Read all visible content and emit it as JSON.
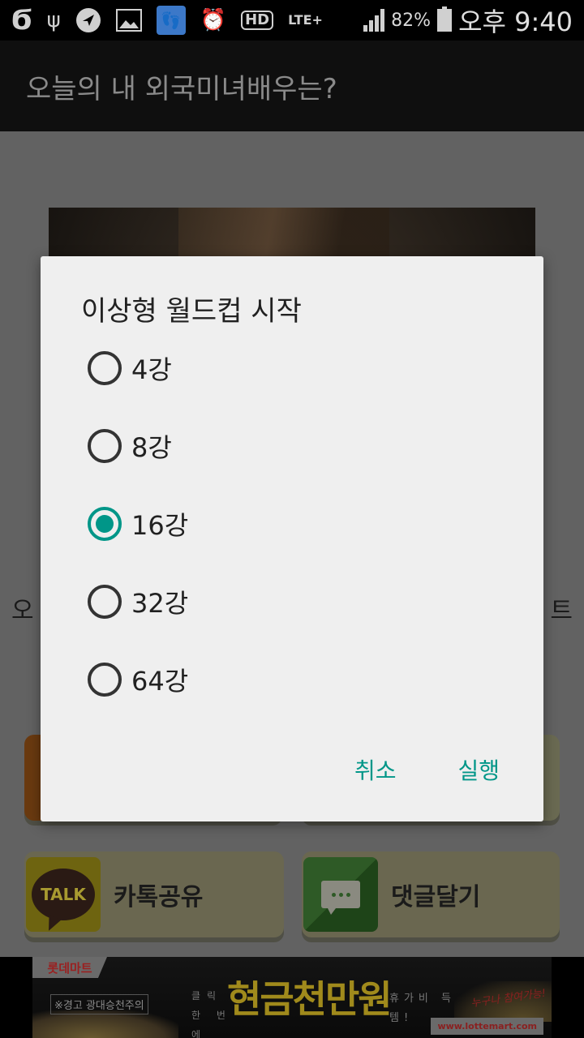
{
  "status_bar": {
    "icons": [
      "g-app-icon",
      "usb-icon",
      "navigation-icon",
      "gallery-icon",
      "app-footprint-icon",
      "alarm-icon",
      "hd-voice-icon",
      "lte-plus-icon",
      "signal-icon",
      "battery-charging-icon"
    ],
    "hd_label": "HD",
    "lte_label": "LTE+",
    "battery_percent": "82%",
    "time": "오후 9:40"
  },
  "app_bar": {
    "title": "오늘의 내 외국미녀배우는?"
  },
  "content": {
    "side_text_left": "오",
    "side_text_right": "트",
    "buttons": [
      {
        "label": "카톡공유",
        "icon": "kakaotalk-icon",
        "icon_text": "TALK"
      },
      {
        "label": "댓글달기",
        "icon": "comment-icon"
      }
    ]
  },
  "dialog": {
    "title": "이상형 월드컵 시작",
    "options": [
      {
        "label": "4강",
        "checked": false
      },
      {
        "label": "8강",
        "checked": false
      },
      {
        "label": "16강",
        "checked": true
      },
      {
        "label": "32강",
        "checked": false
      },
      {
        "label": "64강",
        "checked": false
      }
    ],
    "selected_option": "16강",
    "cancel_label": "취소",
    "confirm_label": "실행",
    "accent_color": "#009688"
  },
  "ad_banner": {
    "brand": "롯데마트",
    "warning": "※경고 광대승천주의",
    "click_text": "클릭 한 번에",
    "headline": "현금천만원",
    "sub_text": "휴가비 득템!",
    "slogan": "누구나 참여가능!",
    "url": "www.lottemart.com"
  }
}
